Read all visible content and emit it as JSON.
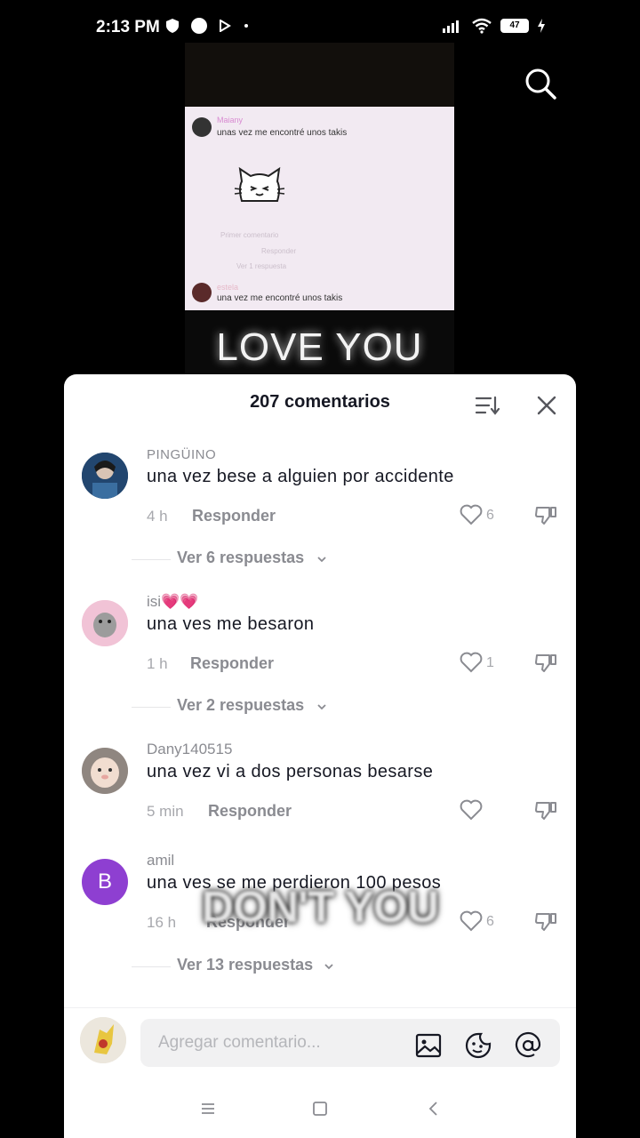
{
  "status_bar": {
    "time": "2:13 PM",
    "battery": "47"
  },
  "video": {
    "card_name_1": "Maiany",
    "card_text_1": "unas vez me encontré unos takis",
    "card_first_comment": "Primer comentario",
    "card_reply": "Responder",
    "card_replies": "Ver 1 respuesta",
    "card_name_2": "estela",
    "card_text_2": "una vez me encontré unos takis",
    "overlay_top": "LOVE YOU",
    "overlay_bottom": "DON'T YOU"
  },
  "sheet": {
    "title": "207 comentarios"
  },
  "comments": [
    {
      "author": "PINGÜINO",
      "text": "una vez bese a alguien por accidente",
      "time": "4 h",
      "reply": "Responder",
      "likes": "6",
      "replies": "Ver 6 respuestas"
    },
    {
      "author": "isi💗💗",
      "text": "una ves me besaron",
      "time": "1 h",
      "reply": "Responder",
      "likes": "1",
      "replies": "Ver 2 respuestas"
    },
    {
      "author": "Dany140515",
      "text": "una vez vi a dos personas besarse",
      "time": "5 min",
      "reply": "Responder",
      "likes": ""
    },
    {
      "author": "amil",
      "avatar_letter": "B",
      "text": "una ves se me perdieron 100 pesos",
      "time": "16 h",
      "reply": "Responder",
      "likes": "6",
      "replies": "Ver 13 respuestas"
    }
  ],
  "input": {
    "placeholder": "Agregar comentario..."
  },
  "colors": {
    "avatar_purple": "#8e3fd1",
    "sheet_bg": "#ffffff",
    "muted": "#8a8b91"
  }
}
